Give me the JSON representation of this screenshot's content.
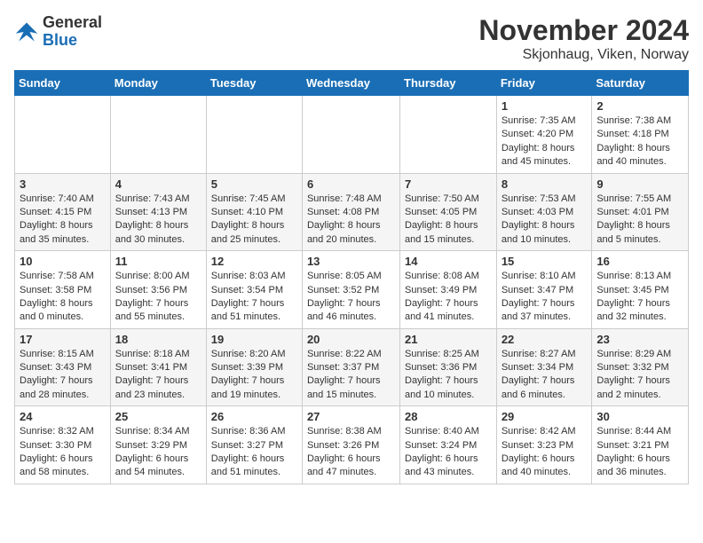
{
  "logo": {
    "text_general": "General",
    "text_blue": "Blue"
  },
  "title": "November 2024",
  "location": "Skjonhaug, Viken, Norway",
  "days_of_week": [
    "Sunday",
    "Monday",
    "Tuesday",
    "Wednesday",
    "Thursday",
    "Friday",
    "Saturday"
  ],
  "weeks": [
    [
      {
        "day": "",
        "info": ""
      },
      {
        "day": "",
        "info": ""
      },
      {
        "day": "",
        "info": ""
      },
      {
        "day": "",
        "info": ""
      },
      {
        "day": "",
        "info": ""
      },
      {
        "day": "1",
        "info": "Sunrise: 7:35 AM\nSunset: 4:20 PM\nDaylight: 8 hours and 45 minutes."
      },
      {
        "day": "2",
        "info": "Sunrise: 7:38 AM\nSunset: 4:18 PM\nDaylight: 8 hours and 40 minutes."
      }
    ],
    [
      {
        "day": "3",
        "info": "Sunrise: 7:40 AM\nSunset: 4:15 PM\nDaylight: 8 hours and 35 minutes."
      },
      {
        "day": "4",
        "info": "Sunrise: 7:43 AM\nSunset: 4:13 PM\nDaylight: 8 hours and 30 minutes."
      },
      {
        "day": "5",
        "info": "Sunrise: 7:45 AM\nSunset: 4:10 PM\nDaylight: 8 hours and 25 minutes."
      },
      {
        "day": "6",
        "info": "Sunrise: 7:48 AM\nSunset: 4:08 PM\nDaylight: 8 hours and 20 minutes."
      },
      {
        "day": "7",
        "info": "Sunrise: 7:50 AM\nSunset: 4:05 PM\nDaylight: 8 hours and 15 minutes."
      },
      {
        "day": "8",
        "info": "Sunrise: 7:53 AM\nSunset: 4:03 PM\nDaylight: 8 hours and 10 minutes."
      },
      {
        "day": "9",
        "info": "Sunrise: 7:55 AM\nSunset: 4:01 PM\nDaylight: 8 hours and 5 minutes."
      }
    ],
    [
      {
        "day": "10",
        "info": "Sunrise: 7:58 AM\nSunset: 3:58 PM\nDaylight: 8 hours and 0 minutes."
      },
      {
        "day": "11",
        "info": "Sunrise: 8:00 AM\nSunset: 3:56 PM\nDaylight: 7 hours and 55 minutes."
      },
      {
        "day": "12",
        "info": "Sunrise: 8:03 AM\nSunset: 3:54 PM\nDaylight: 7 hours and 51 minutes."
      },
      {
        "day": "13",
        "info": "Sunrise: 8:05 AM\nSunset: 3:52 PM\nDaylight: 7 hours and 46 minutes."
      },
      {
        "day": "14",
        "info": "Sunrise: 8:08 AM\nSunset: 3:49 PM\nDaylight: 7 hours and 41 minutes."
      },
      {
        "day": "15",
        "info": "Sunrise: 8:10 AM\nSunset: 3:47 PM\nDaylight: 7 hours and 37 minutes."
      },
      {
        "day": "16",
        "info": "Sunrise: 8:13 AM\nSunset: 3:45 PM\nDaylight: 7 hours and 32 minutes."
      }
    ],
    [
      {
        "day": "17",
        "info": "Sunrise: 8:15 AM\nSunset: 3:43 PM\nDaylight: 7 hours and 28 minutes."
      },
      {
        "day": "18",
        "info": "Sunrise: 8:18 AM\nSunset: 3:41 PM\nDaylight: 7 hours and 23 minutes."
      },
      {
        "day": "19",
        "info": "Sunrise: 8:20 AM\nSunset: 3:39 PM\nDaylight: 7 hours and 19 minutes."
      },
      {
        "day": "20",
        "info": "Sunrise: 8:22 AM\nSunset: 3:37 PM\nDaylight: 7 hours and 15 minutes."
      },
      {
        "day": "21",
        "info": "Sunrise: 8:25 AM\nSunset: 3:36 PM\nDaylight: 7 hours and 10 minutes."
      },
      {
        "day": "22",
        "info": "Sunrise: 8:27 AM\nSunset: 3:34 PM\nDaylight: 7 hours and 6 minutes."
      },
      {
        "day": "23",
        "info": "Sunrise: 8:29 AM\nSunset: 3:32 PM\nDaylight: 7 hours and 2 minutes."
      }
    ],
    [
      {
        "day": "24",
        "info": "Sunrise: 8:32 AM\nSunset: 3:30 PM\nDaylight: 6 hours and 58 minutes."
      },
      {
        "day": "25",
        "info": "Sunrise: 8:34 AM\nSunset: 3:29 PM\nDaylight: 6 hours and 54 minutes."
      },
      {
        "day": "26",
        "info": "Sunrise: 8:36 AM\nSunset: 3:27 PM\nDaylight: 6 hours and 51 minutes."
      },
      {
        "day": "27",
        "info": "Sunrise: 8:38 AM\nSunset: 3:26 PM\nDaylight: 6 hours and 47 minutes."
      },
      {
        "day": "28",
        "info": "Sunrise: 8:40 AM\nSunset: 3:24 PM\nDaylight: 6 hours and 43 minutes."
      },
      {
        "day": "29",
        "info": "Sunrise: 8:42 AM\nSunset: 3:23 PM\nDaylight: 6 hours and 40 minutes."
      },
      {
        "day": "30",
        "info": "Sunrise: 8:44 AM\nSunset: 3:21 PM\nDaylight: 6 hours and 36 minutes."
      }
    ]
  ]
}
